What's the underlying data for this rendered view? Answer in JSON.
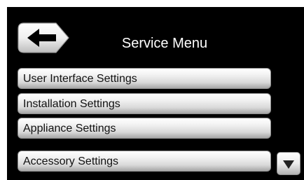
{
  "header": {
    "title": "Service Menu",
    "back_icon": "arrow-left-icon"
  },
  "menu": {
    "items": [
      {
        "label": "User Interface Settings"
      },
      {
        "label": "Installation Settings"
      },
      {
        "label": "Appliance Settings"
      },
      {
        "label": "Accessory Settings"
      }
    ]
  },
  "scroll": {
    "down_icon": "triangle-down-icon"
  },
  "colors": {
    "background": "#000000",
    "title_text": "#ffffff",
    "button_text": "#111111"
  }
}
